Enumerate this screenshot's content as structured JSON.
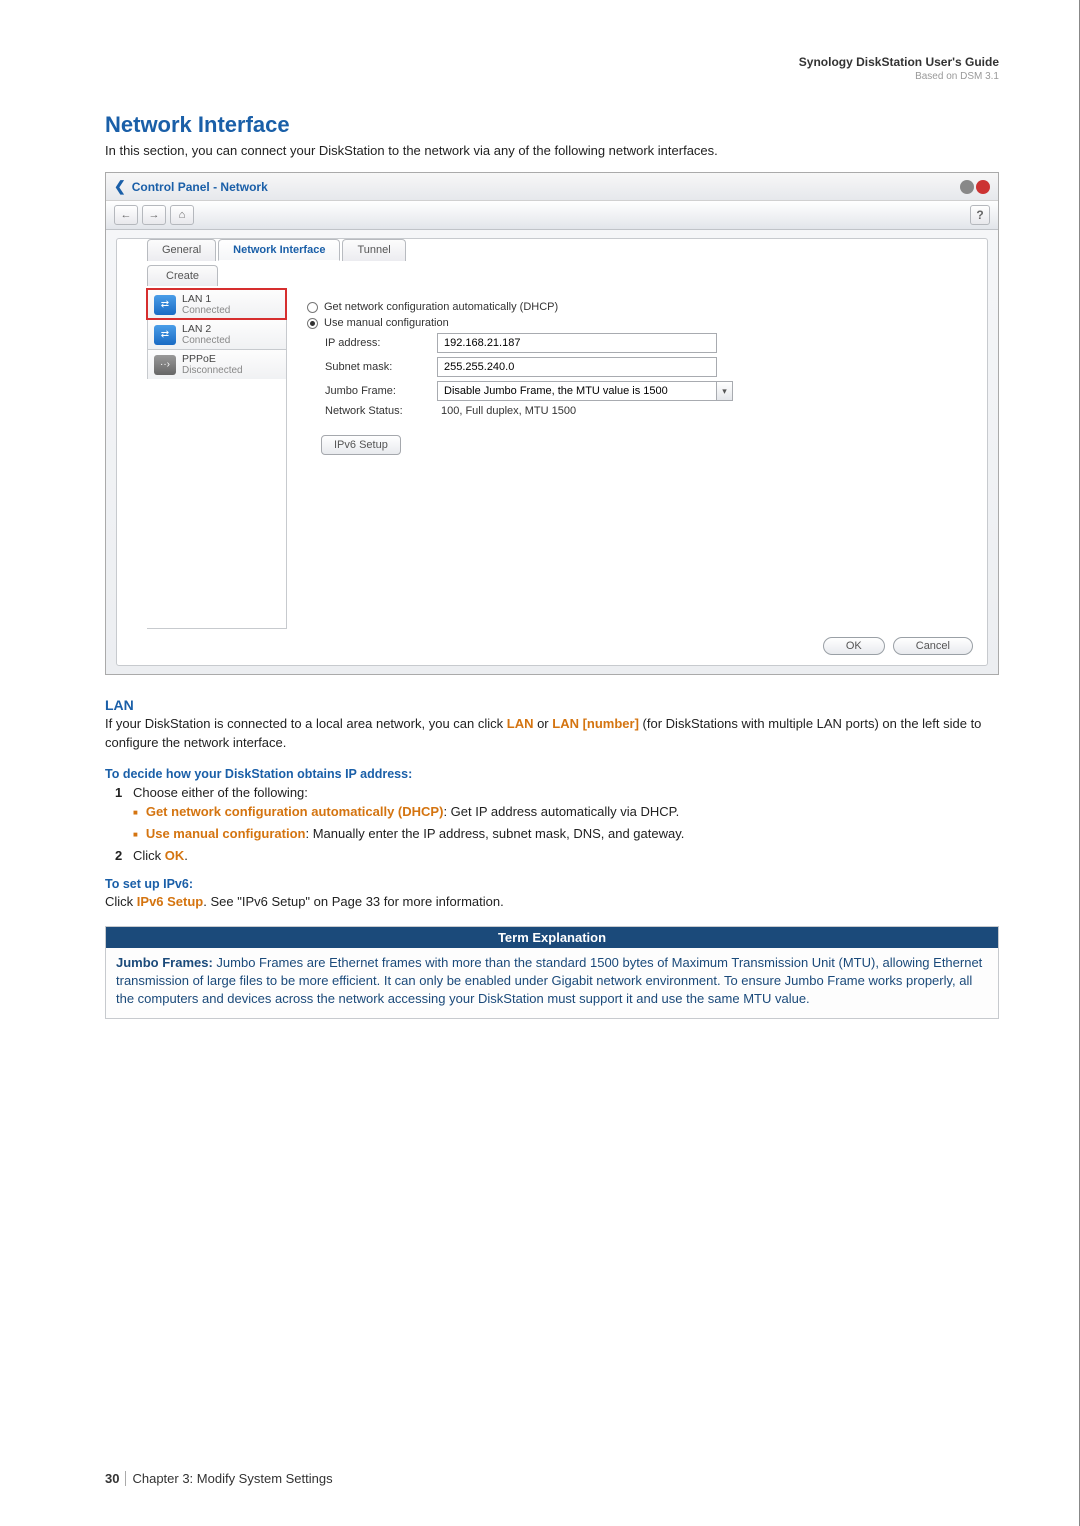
{
  "header": {
    "title": "Synology DiskStation User's Guide",
    "sub": "Based on DSM 3.1"
  },
  "section": {
    "title": "Network Interface",
    "intro": "In this section, you can connect your DiskStation to the network via any of the following network interfaces."
  },
  "window": {
    "title": "Control Panel - Network",
    "tabs": {
      "general": "General",
      "netif": "Network Interface",
      "tunnel": "Tunnel"
    },
    "create": "Create",
    "side": {
      "lan1": {
        "name": "LAN 1",
        "status": "Connected"
      },
      "lan2": {
        "name": "LAN 2",
        "status": "Connected"
      },
      "pppoe": {
        "name": "PPPoE",
        "status": "Disconnected"
      }
    },
    "form": {
      "dhcp": "Get network configuration automatically (DHCP)",
      "manual": "Use manual configuration",
      "ip_label": "IP address:",
      "ip_value": "192.168.21.187",
      "mask_label": "Subnet mask:",
      "mask_value": "255.255.240.0",
      "jumbo_label": "Jumbo Frame:",
      "jumbo_value": "Disable Jumbo Frame, the MTU value is 1500",
      "status_label": "Network Status:",
      "status_value": "100, Full duplex, MTU 1500",
      "ipv6_btn": "IPv6 Setup"
    },
    "buttons": {
      "ok": "OK",
      "cancel": "Cancel"
    }
  },
  "lan": {
    "title": "LAN",
    "text_a": "If your DiskStation is connected to a local area network, you can click ",
    "lan_label": "LAN",
    "or": " or ",
    "lan_num": "LAN [number]",
    "text_b": " (for DiskStations with multiple LAN ports) on the left side to configure the network interface.",
    "decide": "To decide how your DiskStation obtains IP address:",
    "step1": "Choose either of the following:",
    "opt1_bold": "Get network configuration automatically (DHCP)",
    "opt1_rest": ": Get IP address automatically via DHCP.",
    "opt2_bold": "Use manual configuration",
    "opt2_rest": ": Manually enter the IP address, subnet mask, DNS, and gateway.",
    "step2_a": "Click ",
    "step2_ok": "OK",
    "step2_b": ".",
    "ipv6_head": "To set up IPv6:",
    "ipv6_a": "Click ",
    "ipv6_btn": "IPv6 Setup",
    "ipv6_b": ". See \"IPv6 Setup\" on Page 33 for more information."
  },
  "term": {
    "head": "Term Explanation",
    "lead": "Jumbo Frames:",
    "body": " Jumbo Frames are Ethernet frames with more than the standard 1500 bytes of Maximum Transmission Unit (MTU), allowing Ethernet transmission of large files to be more efficient. It can only be enabled under Gigabit network environment. To ensure Jumbo Frame works properly, all the computers and devices across the network accessing your DiskStation must support it and use the same MTU value."
  },
  "footer": {
    "page": "30",
    "chapter": "Chapter 3: Modify System Settings"
  }
}
